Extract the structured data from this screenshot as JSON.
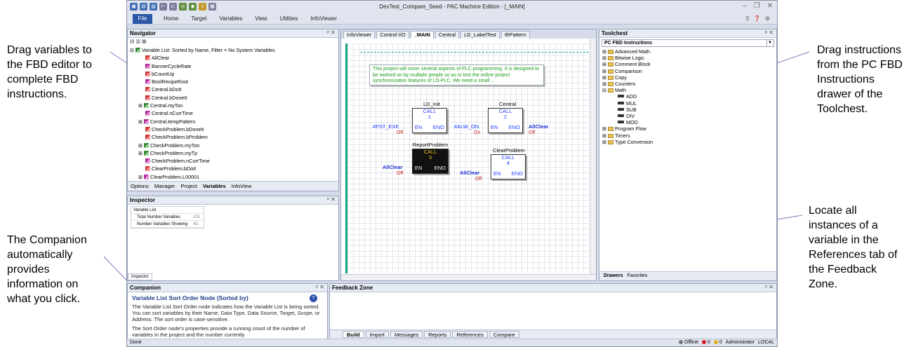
{
  "callouts": {
    "drag_variables": "Drag variables to\nthe FBD editor to\ncomplete FBD\ninstructions.",
    "companion": "The Companion\nautomatically\nprovides\ninformation on\nwhat you click.",
    "drag_instructions": "Drag instructions\nfrom the PC FBD\nInstructions\ndrawer of the\nToolchest.",
    "references": "Locate all\ninstances of a\nvariable in the\nReferences tab of\nthe Feedback\nZone."
  },
  "window": {
    "title": "DevTest_Compare_Seed - PAC Machine Edition - [_MAIN]",
    "ribbon_file": "File",
    "ribbon_tabs": [
      "Home",
      "Target",
      "Variables",
      "View",
      "Utilities",
      "InfoViewer"
    ]
  },
  "navigator": {
    "title": "Navigator",
    "root": "Variable List: Sorted by Name, Filter = No System Variables",
    "items": [
      {
        "label": "AllClear",
        "icon": "red"
      },
      {
        "label": "BannerCycleRate",
        "icon": "mag"
      },
      {
        "label": "bCountUp",
        "icon": "red"
      },
      {
        "label": "BoolRecipeRoot",
        "icon": "mag"
      },
      {
        "label": "Central.bDoIt",
        "icon": "red"
      },
      {
        "label": "Central.bDoneIt",
        "icon": "red"
      },
      {
        "label": "Central.myTon",
        "icon": "grn"
      },
      {
        "label": "Central.nCurrTime",
        "icon": "mag"
      },
      {
        "label": "Central.tempPattern",
        "icon": "mag"
      },
      {
        "label": "CheckProblem.bDoneIt",
        "icon": "red"
      },
      {
        "label": "CheckProblem.bProblem",
        "icon": "red"
      },
      {
        "label": "CheckProblem.myTon",
        "icon": "grn"
      },
      {
        "label": "CheckProblem.myTp",
        "icon": "grn"
      },
      {
        "label": "CheckProblem.nCurrTime",
        "icon": "mag"
      },
      {
        "label": "ClearProblem.bDoIt",
        "icon": "red"
      },
      {
        "label": "ClearProblem.L00001",
        "icon": "mag"
      }
    ],
    "tabs": [
      "Options",
      "Manager",
      "Project",
      "Variables",
      "InfoView"
    ]
  },
  "inspector": {
    "title": "Inspector",
    "rows": [
      {
        "label": "Variable List",
        "value": ""
      },
      {
        "label": "Total Number Variables",
        "value": "101"
      },
      {
        "label": "Number Variables Showing",
        "value": "43"
      }
    ],
    "tab": "Inspector"
  },
  "editor": {
    "tabs": [
      "InfoViewer",
      "Control I/O",
      "_MAIN",
      "Central",
      "LD_LabelTest",
      "tfrPattern"
    ],
    "active_tab": "_MAIN",
    "note": "This project will cover several aspects of PLC programming.  It is designed to be worked on by multiple people so as to test the online project synchronization features of LD-PLC.  We need a small ...",
    "blocks": [
      {
        "name": "LD_Init",
        "call": "CALL",
        "num": "1",
        "en": "EN",
        "eno": "ENO",
        "input": "#FST_EXE",
        "input_state": "Off",
        "output": ""
      },
      {
        "name": "Central",
        "call": "CALL",
        "num": "2",
        "en": "EN",
        "eno": "ENO",
        "input": "#ALW_ON",
        "input_state": "On",
        "output": "AllClear",
        "output_state": "Off"
      },
      {
        "name": "ReportProblem",
        "call": "CALL",
        "num": "3",
        "en": "EN",
        "eno": "ENO",
        "input": "AllClear",
        "input_state": "Off",
        "output": ""
      },
      {
        "name": "ClearProblem",
        "call": "CALL",
        "num": "4",
        "en": "EN",
        "eno": "ENO",
        "input": "AllClear",
        "input_state": "Off",
        "output": ""
      }
    ]
  },
  "toolchest": {
    "title": "Toolchest",
    "drawer": "PC FBD Instructions",
    "items": [
      {
        "label": "Advanced Math",
        "sub": false
      },
      {
        "label": "Bitwise Logic",
        "sub": false
      },
      {
        "label": "Comment Block",
        "sub": false
      },
      {
        "label": "Comparison",
        "sub": false
      },
      {
        "label": "Copy",
        "sub": false
      },
      {
        "label": "Counters",
        "sub": false
      },
      {
        "label": "Math",
        "sub": false
      },
      {
        "label": "ADD",
        "sub": true
      },
      {
        "label": "MUL",
        "sub": true
      },
      {
        "label": "SUB",
        "sub": true
      },
      {
        "label": "DIV",
        "sub": true
      },
      {
        "label": "MOD",
        "sub": true
      },
      {
        "label": "Program Flow",
        "sub": false
      },
      {
        "label": "Timers",
        "sub": false
      },
      {
        "label": "Type Conversion",
        "sub": false
      }
    ],
    "tabs": [
      "Drawers",
      "Favorites"
    ]
  },
  "companion": {
    "title": "Companion",
    "heading": "Variable List Sort Order Node (Sorted by)",
    "para1": "The Variable List Sort Order node indicates how the Variable List is being sorted. You can sort variables by their Name, Data Type, Data Source, Target, Scope, or Address. The sort order is case-sensitive.",
    "para2": "The Sort Order node's properties provide a running count of the number of variables in the project and the number currently"
  },
  "feedback": {
    "title": "Feedback Zone",
    "tabs": [
      "Build",
      "Import",
      "Messages",
      "Reports",
      "References",
      "Compare"
    ]
  },
  "status": {
    "left": "Done",
    "offline": "Offline",
    "err_count": "0",
    "warn_count": "0",
    "user": "Administrator",
    "mode": "LOCAL"
  },
  "colors": {
    "accent": "#2b58a6",
    "signal_blue": "#2040ff",
    "state_red": "#c02020",
    "note_green": "#1a9a1a"
  }
}
